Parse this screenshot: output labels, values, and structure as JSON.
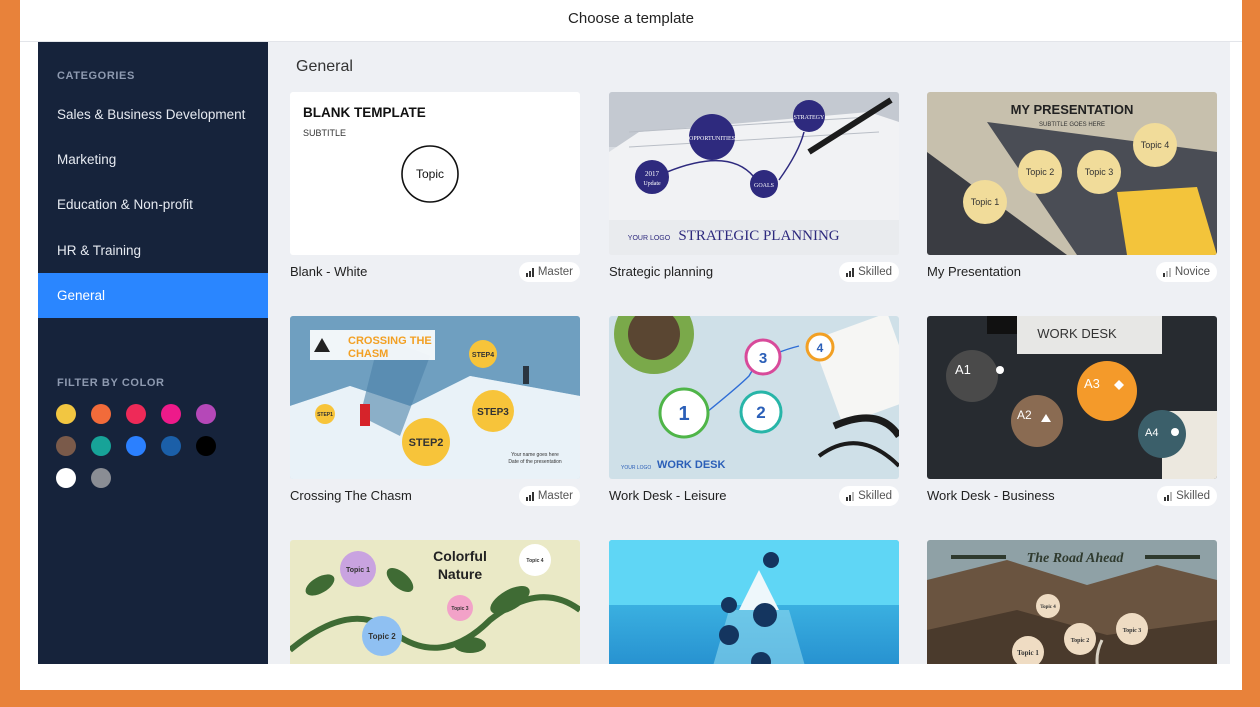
{
  "dialog": {
    "title": "Choose a template"
  },
  "sidebar": {
    "categories_heading": "CATEGORIES",
    "categories": [
      {
        "label": "Sales & Business Development",
        "active": false
      },
      {
        "label": "Marketing",
        "active": false
      },
      {
        "label": "Education & Non-profit",
        "active": false
      },
      {
        "label": "HR & Training",
        "active": false
      },
      {
        "label": "General",
        "active": true
      }
    ],
    "filter_heading": "FILTER BY COLOR",
    "colors": [
      "#f2c641",
      "#f26b3a",
      "#ee2a58",
      "#ee1a8a",
      "#b548b8",
      "#7a5a4a",
      "#17a398",
      "#2b80ff",
      "#1b5fa8",
      "#000000",
      "#ffffff",
      "#8a8d94"
    ]
  },
  "main": {
    "section_title": "General",
    "templates": [
      {
        "name": "Blank - White",
        "level": "Master",
        "thumb_texts": {
          "title": "BLANK TEMPLATE",
          "subtitle": "SUBTITLE",
          "topic": "Topic"
        }
      },
      {
        "name": "Strategic planning",
        "level": "Skilled",
        "thumb_texts": {
          "a": "OPPORTUNITIES",
          "b": "STRATEGY",
          "c": "2017",
          "d": "Update",
          "e": "GOALS",
          "f": "STRATEGIC PLANNING",
          "g": "YOUR LOGO"
        }
      },
      {
        "name": "My Presentation",
        "level": "Novice",
        "thumb_texts": {
          "title": "MY PRESENTATION",
          "subtitle": "SUBTITLE GOES HERE",
          "t1": "Topic 1",
          "t2": "Topic 2",
          "t3": "Topic 3",
          "t4": "Topic 4"
        }
      },
      {
        "name": "Crossing The Chasm",
        "level": "Master",
        "thumb_texts": {
          "title1": "CROSSING THE",
          "title2": "CHASM",
          "s1": "STEP1",
          "s2": "STEP2",
          "s3": "STEP3",
          "s4": "STEP4",
          "foot1": "Your name goes here",
          "foot2": "Date of the presentation"
        }
      },
      {
        "name": "Work Desk - Leisure",
        "level": "Skilled",
        "thumb_texts": {
          "n1": "1",
          "n2": "2",
          "n3": "3",
          "n4": "4",
          "title": "WORK DESK",
          "logo": "YOUR LOGO"
        }
      },
      {
        "name": "Work Desk - Business",
        "level": "Skilled",
        "thumb_texts": {
          "title": "WORK DESK",
          "a1": "A1",
          "a2": "A2",
          "a3": "A3",
          "a4": "A4"
        }
      },
      {
        "name": "Colorful Nature",
        "level": "",
        "thumb_texts": {
          "title1": "Colorful",
          "title2": "Nature",
          "t1": "Topic 1",
          "t2": "Topic 2",
          "t3": "Topic 3",
          "t4": "Topic 4"
        }
      },
      {
        "name": "Iceberg",
        "level": "",
        "thumb_texts": {}
      },
      {
        "name": "The Road Ahead",
        "level": "",
        "thumb_texts": {
          "title": "The Road Ahead",
          "t1": "Topic 1",
          "t2": "Topic 2",
          "t3": "Topic 3",
          "t4": "Topic 4"
        }
      }
    ]
  }
}
